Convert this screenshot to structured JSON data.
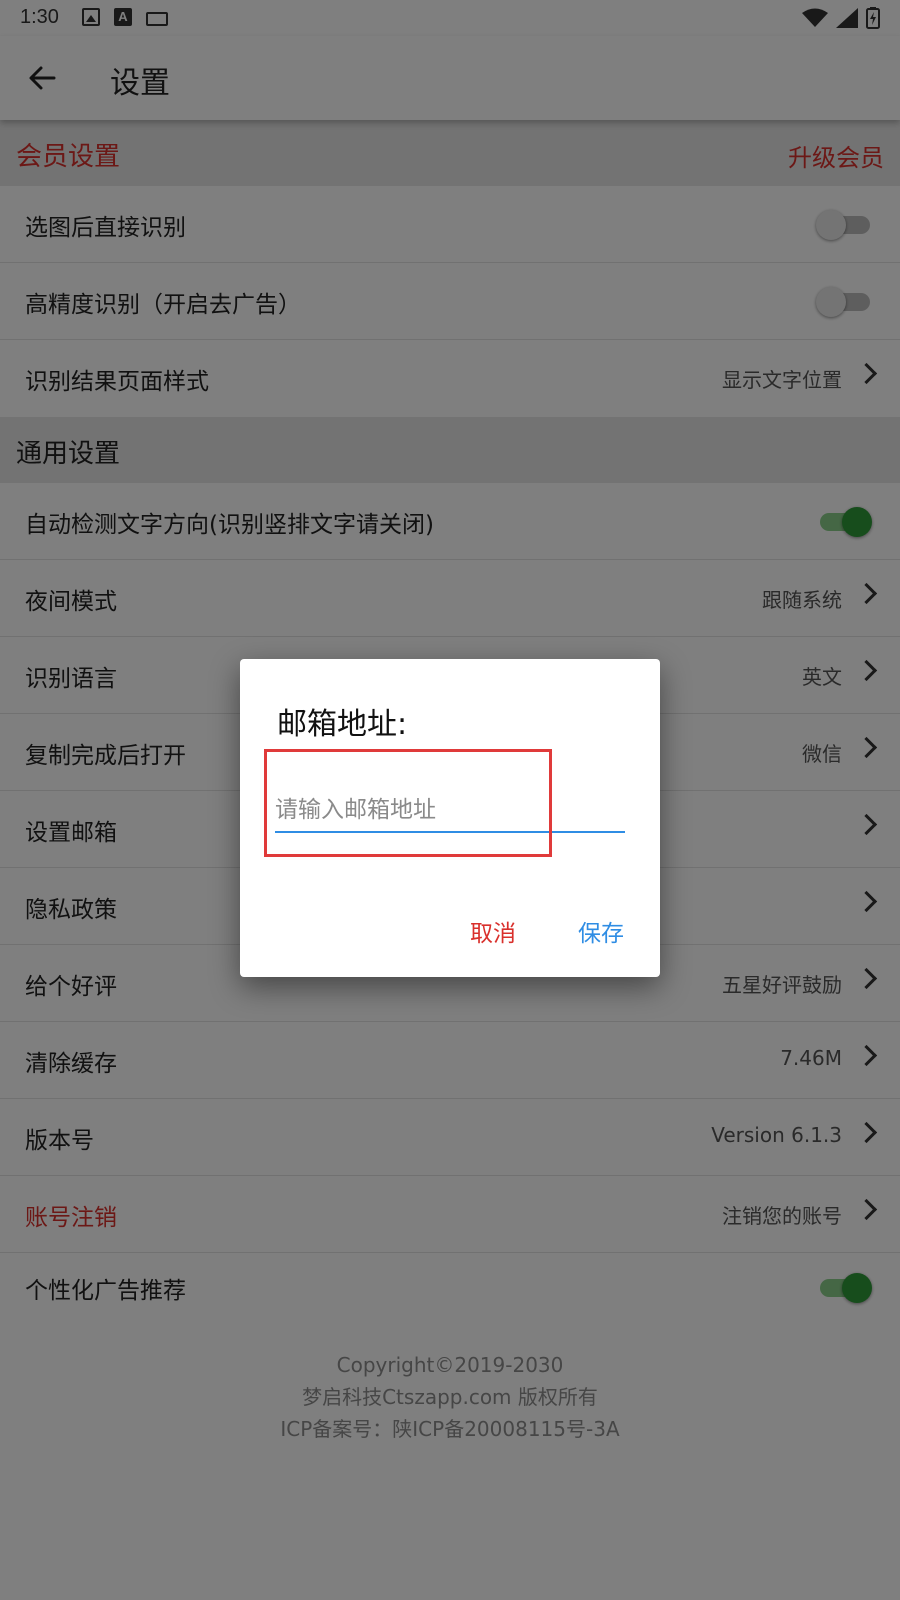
{
  "status": {
    "time": "1:30"
  },
  "appbar": {
    "title": "设置"
  },
  "colors": {
    "red": "#d9302c",
    "blue": "#2f8de4",
    "green": "#2e9a38"
  },
  "member_section": {
    "title": "会员设置",
    "action": "升级会员"
  },
  "member_rows": [
    {
      "label": "选图后直接识别",
      "toggle": false
    },
    {
      "label": "高精度识别（开启去广告）",
      "toggle": false
    },
    {
      "label": "识别结果页面样式",
      "value": "显示文字位置"
    }
  ],
  "general_section": {
    "title": "通用设置"
  },
  "general_rows": [
    {
      "label": "自动检测文字方向(识别竖排文字请关闭)",
      "toggle": true
    },
    {
      "label": "夜间模式",
      "value": "跟随系统"
    },
    {
      "label": "识别语言",
      "value": "英文"
    },
    {
      "label": "复制完成后打开",
      "value": "微信"
    },
    {
      "label": "设置邮箱",
      "value": ""
    },
    {
      "label": "隐私政策",
      "value": ""
    },
    {
      "label": "给个好评",
      "value": "五星好评鼓励"
    },
    {
      "label": "清除缓存",
      "value": "7.46M"
    },
    {
      "label": "版本号",
      "value": "Version 6.1.3"
    },
    {
      "label": "账号注销",
      "value": "注销您的账号"
    },
    {
      "label": "个性化广告推荐",
      "toggle": true
    }
  ],
  "footer": {
    "line1": "Copyright©2019-2030",
    "line2": "梦启科技Ctszapp.com 版权所有",
    "line3": "ICP备案号：陕ICP备20008115号-3A"
  },
  "dialog": {
    "title": "邮箱地址:",
    "input_value": "",
    "input_placeholder": "请输入邮箱地址",
    "cancel_label": "取消",
    "save_label": "保存"
  }
}
